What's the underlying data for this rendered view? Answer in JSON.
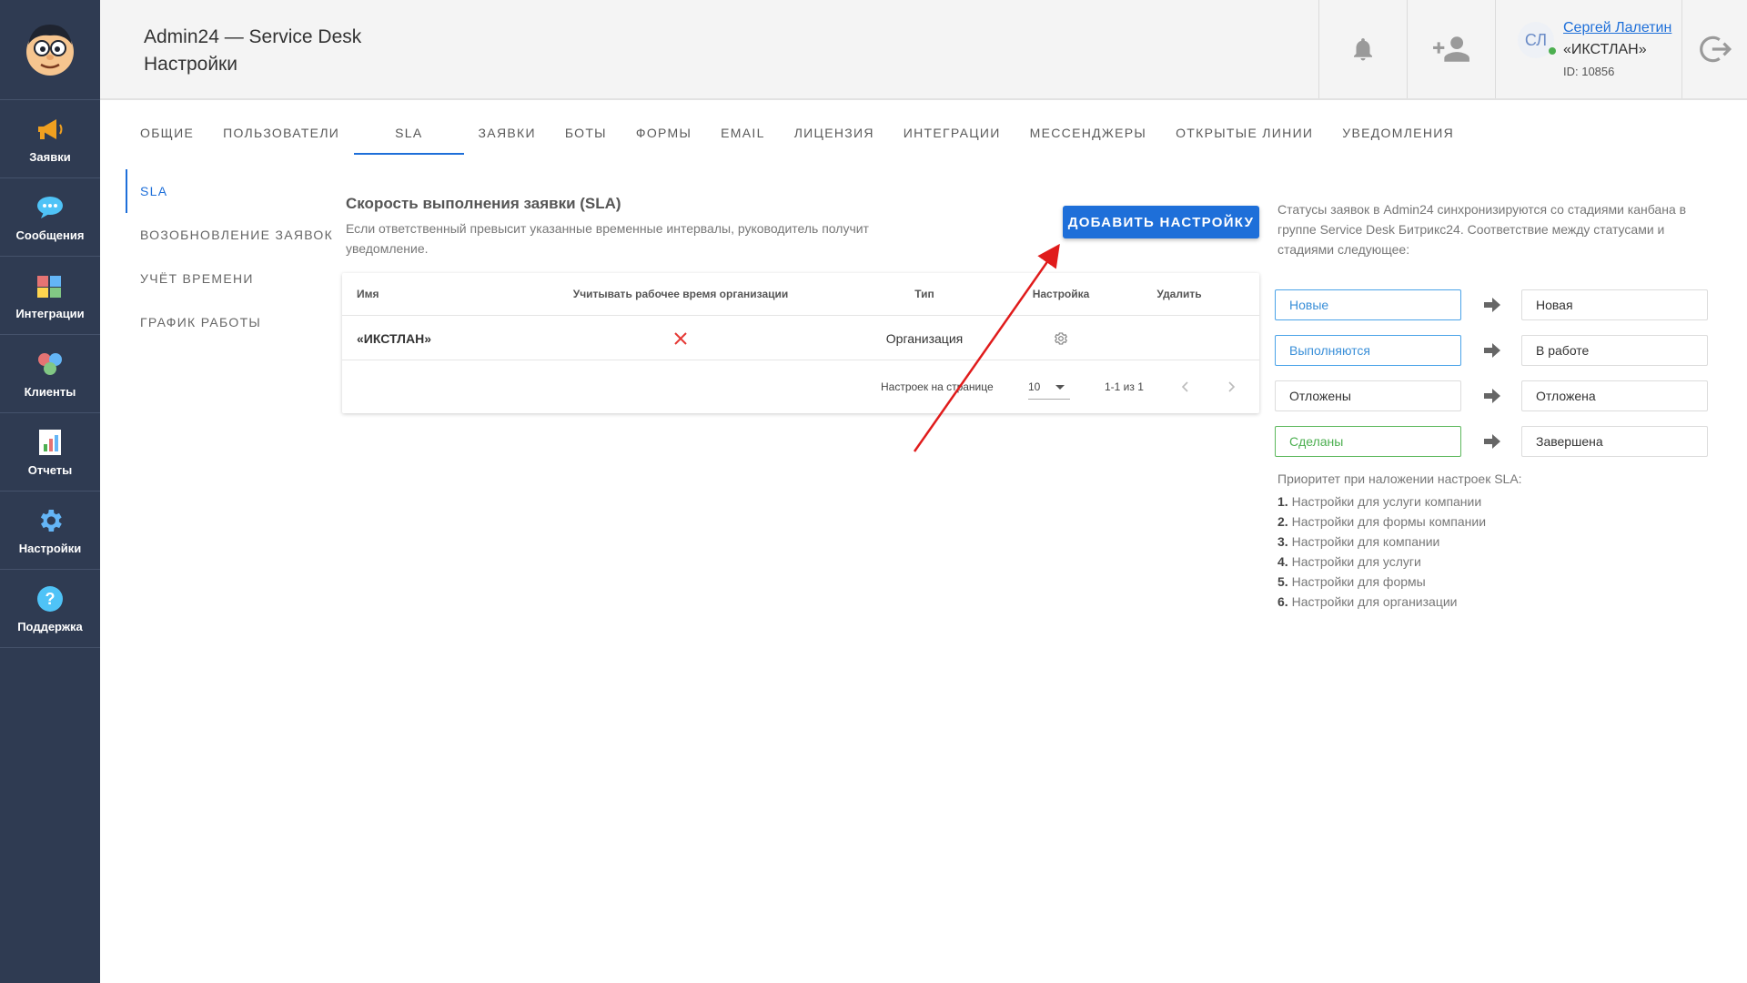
{
  "sidebar": {
    "items": [
      {
        "label": "Заявки",
        "icon": "megaphone-icon"
      },
      {
        "label": "Сообщения",
        "icon": "chat-bubble-icon"
      },
      {
        "label": "Интеграции",
        "icon": "puzzle-icon"
      },
      {
        "label": "Клиенты",
        "icon": "clients-icon"
      },
      {
        "label": "Отчеты",
        "icon": "report-chart-icon"
      },
      {
        "label": "Настройки",
        "icon": "gear-icon"
      },
      {
        "label": "Поддержка",
        "icon": "help-icon"
      }
    ]
  },
  "header": {
    "title": "Admin24 — Service Desk",
    "subtitle": "Настройки",
    "user": {
      "initials": "СЛ",
      "name": "Сергей Лалетин",
      "org": "«ИКСТЛАН»",
      "id": "ID: 10856"
    }
  },
  "tabs": [
    "ОБЩИЕ",
    "ПОЛЬЗОВАТЕЛИ",
    "SLA",
    "ЗАЯВКИ",
    "БОТЫ",
    "ФОРМЫ",
    "EMAIL",
    "ЛИЦЕНЗИЯ",
    "ИНТЕГРАЦИИ",
    "МЕССЕНДЖЕРЫ",
    "ОТКРЫТЫЕ ЛИНИИ",
    "УВЕДОМЛЕНИЯ"
  ],
  "active_tab": "SLA",
  "subnav": [
    "SLA",
    "ВОЗОБНОВЛЕНИЕ ЗАЯВОК",
    "УЧЁТ ВРЕМЕНИ",
    "ГРАФИК РАБОТЫ"
  ],
  "active_subnav": "SLA",
  "section": {
    "title": "Скорость выполнения заявки (SLA)",
    "description": "Если ответственный превысит указанные временные интервалы, руководитель получит уведомление.",
    "add_button": "ДОБАВИТЬ НАСТРОЙКУ"
  },
  "table": {
    "columns": [
      "Имя",
      "Учитывать рабочее время организации",
      "Тип",
      "Настройка",
      "Удалить"
    ],
    "rows": [
      {
        "name": "«ИКСТЛАН»",
        "use_org_work_time": false,
        "type": "Организация",
        "settings_icon": "gear-icon"
      }
    ],
    "footer": {
      "per_page_label": "Настроек на странице",
      "per_page_value": "10",
      "range": "1-1 из 1"
    }
  },
  "right_panel": {
    "description": "Статусы заявок в Admin24 синхронизируются со стадиями канбана в группе Service Desk Битрикс24. Соответствие между статусами и стадиями следующее:",
    "mappings": [
      {
        "status": "Новые",
        "stage": "Новая",
        "border_color": "#4aa3e8",
        "text_color": "#3a8fd8"
      },
      {
        "status": "Выполняются",
        "stage": "В работе",
        "border_color": "#4aa3e8",
        "text_color": "#3a8fd8"
      },
      {
        "status": "Отложены",
        "stage": "Отложена",
        "border_color": "#dcdcdc",
        "text_color": "#333333"
      },
      {
        "status": "Сделаны",
        "stage": "Завершена",
        "border_color": "#5cb85c",
        "text_color": "#4caf50"
      }
    ],
    "priority_title": "Приоритет при наложении настроек SLA:",
    "priority": [
      {
        "num": "1.",
        "text": "Настройки для услуги компании"
      },
      {
        "num": "2.",
        "text": "Настройки для формы компании"
      },
      {
        "num": "3.",
        "text": "Настройки для компании"
      },
      {
        "num": "4.",
        "text": "Настройки для услуги"
      },
      {
        "num": "5.",
        "text": "Настройки для формы"
      },
      {
        "num": "6.",
        "text": "Настройки для организации"
      }
    ]
  },
  "colors": {
    "sidebar_bg": "#2f3b52",
    "accent": "#1e6fd9",
    "annotation_arrow": "#e01b1b",
    "delete_x": "#e53935"
  }
}
